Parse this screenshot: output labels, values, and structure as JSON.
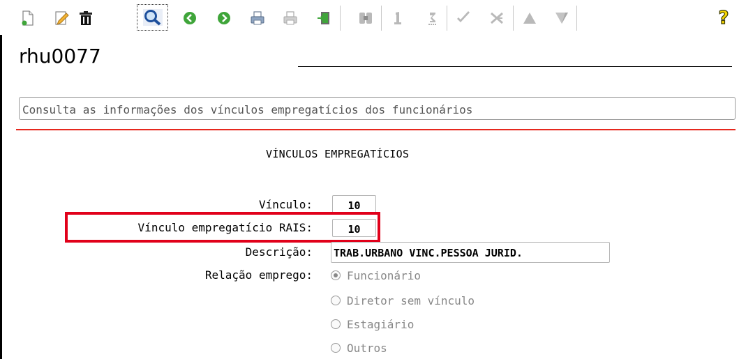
{
  "window": {
    "program_code": "rhu0077"
  },
  "header": {
    "description": "Consulta as informações dos vínculos empregatícios dos funcionários"
  },
  "section": {
    "title": "VÍNCULOS EMPREGATÍCIOS"
  },
  "form": {
    "vinculo": {
      "label": "Vínculo:",
      "value": "10"
    },
    "vinculo_rais": {
      "label": "Vínculo empregatício RAIS:",
      "value": "10"
    },
    "descricao": {
      "label": "Descrição:",
      "value": "TRAB.URBANO VINC.PESSOA JURID."
    },
    "relacao": {
      "label": "Relação emprego:",
      "options": [
        {
          "label": "Funcionário",
          "selected": true
        },
        {
          "label": "Diretor sem vínculo",
          "selected": false
        },
        {
          "label": "Estagiário",
          "selected": false
        },
        {
          "label": "Outros",
          "selected": false
        }
      ]
    }
  },
  "toolbar": {
    "items": [
      {
        "icon": "new-document-icon"
      },
      {
        "icon": "edit-pencil-icon"
      },
      {
        "icon": "trash-icon"
      },
      {
        "icon": "search-magnifier-icon",
        "selected": true
      },
      {
        "icon": "previous-arrow-icon"
      },
      {
        "icon": "next-arrow-icon"
      },
      {
        "icon": "print-icon"
      },
      {
        "icon": "print-disabled-icon"
      },
      {
        "icon": "exit-door-icon"
      },
      {
        "icon": "zoom-field-icon"
      },
      {
        "icon": "first-record-icon"
      },
      {
        "icon": "last-record-icon"
      },
      {
        "icon": "confirm-check-icon"
      },
      {
        "icon": "cancel-x-icon"
      },
      {
        "icon": "move-up-icon"
      },
      {
        "icon": "move-down-icon"
      },
      {
        "icon": "help-question-icon"
      }
    ]
  },
  "colors": {
    "accent_red": "#e6281e",
    "highlight_red": "#e1001a"
  }
}
